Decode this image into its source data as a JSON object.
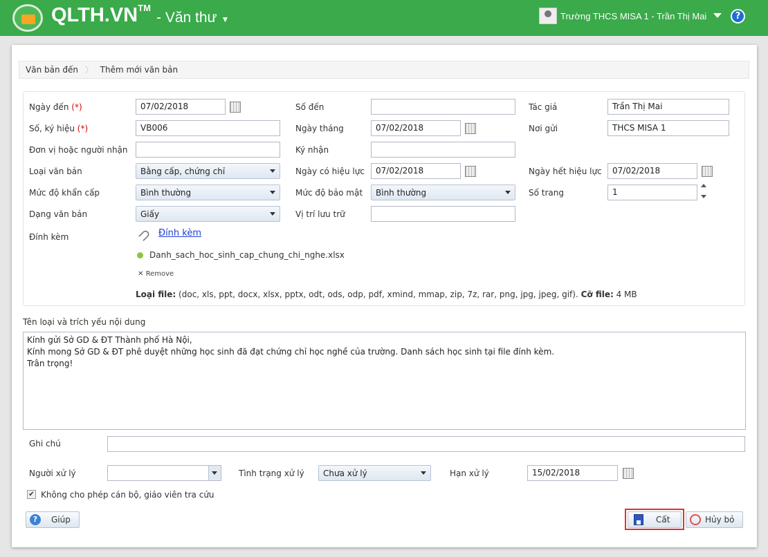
{
  "header": {
    "logo": "QLTH.VN",
    "tm": "TM",
    "module": "- Văn thư",
    "user": "Trường THCS MISA 1 - Trần Thị Mai"
  },
  "breadcrumb": [
    "Văn bản đến",
    "Thêm mới văn bản"
  ],
  "form": {
    "ngay_den": {
      "label": "Ngày đến",
      "req": "(*)",
      "value": "07/02/2018"
    },
    "so_ky_hieu": {
      "label": "Số, ký hiệu",
      "req": "(*)",
      "value": "VB006"
    },
    "don_vi": {
      "label": "Đơn vị hoặc người nhận",
      "value": ""
    },
    "loai_vb": {
      "label": "Loại văn bản",
      "value": "Bằng cấp, chứng chỉ"
    },
    "muc_do_kc": {
      "label": "Mức độ khẩn cấp",
      "value": "Bình thường"
    },
    "dang_vb": {
      "label": "Dạng văn bản",
      "value": "Giấy"
    },
    "so_den": {
      "label": "Số đến",
      "value": ""
    },
    "ngay_thang": {
      "label": "Ngày tháng",
      "value": "07/02/2018"
    },
    "ky_nhan": {
      "label": "Ký nhận",
      "value": ""
    },
    "ngay_hl": {
      "label": "Ngày có hiệu lực",
      "value": "07/02/2018"
    },
    "muc_do_bm": {
      "label": "Mức độ bảo mật",
      "value": "Bình thường"
    },
    "vi_tri": {
      "label": "Vị trí lưu trữ",
      "value": ""
    },
    "tac_gia": {
      "label": "Tác giả",
      "value": "Trần Thị Mai"
    },
    "noi_gui": {
      "label": "Nơi gửi",
      "value": "THCS MISA 1"
    },
    "ngay_het": {
      "label": "Ngày hết hiệu lực",
      "value": "07/02/2018"
    },
    "so_trang": {
      "label": "Số trang",
      "value": "1"
    },
    "dinh_kem": {
      "label": "Đính kèm",
      "link": "Đính kèm",
      "file": "Danh_sach_hoc_sinh_cap_chung_chi_nghe.xlsx",
      "remove": "Remove",
      "type_label": "Loại file:",
      "types": " (doc, xls, ppt, docx, xlsx, pptx, odt, ods, odp, pdf, xmind, mmap, zip, 7z, rar, png, jpg, jpeg, gif). ",
      "size_label": "Cỡ file:",
      "size": " 4 MB"
    }
  },
  "content": {
    "label": "Tên loại và trích yếu nội dung",
    "lines": [
      "Kính gửi Sở GD & ĐT Thành phố Hà Nội,",
      "Kính mong Sở GD & ĐT phê duyệt những học sinh đã đạt chứng chỉ học nghề của trường. Danh sách học sinh tại file đính kèm.",
      "Trân trọng!"
    ]
  },
  "ghi_chu": {
    "label": "Ghi chú",
    "value": ""
  },
  "nguoi_xu_ly": {
    "label": "Người xử lý",
    "value": ""
  },
  "tinh_trang": {
    "label": "Tình trạng xử lý",
    "value": "Chưa xử lý"
  },
  "han_xu_ly": {
    "label": "Hạn xử lý",
    "value": "15/02/2018"
  },
  "checkbox": {
    "label": "Không cho phép cán bộ, giáo viên tra cứu",
    "checked": true
  },
  "buttons": {
    "help": "Giúp",
    "save": "Cất",
    "cancel": "Hủy bỏ"
  }
}
